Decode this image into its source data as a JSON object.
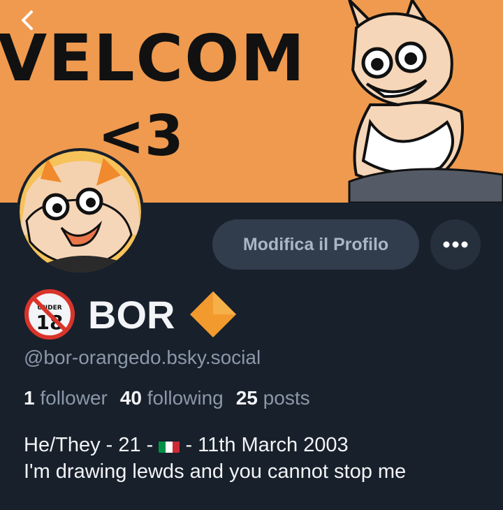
{
  "banner": {
    "text_line1": "VELCOM",
    "text_line2": "<3",
    "background_color": "#ef9a4f"
  },
  "nav": {
    "back_icon": "chevron-left-icon"
  },
  "profile": {
    "display_name": "BOR",
    "name_prefix_icon": "under-18-icon",
    "name_suffix_icon": "orange-diamond-icon",
    "handle": "@bor-orangedo.bsky.social"
  },
  "actions": {
    "edit_label": "Modifica il Profilo",
    "more_icon": "more-dots-icon"
  },
  "stats": {
    "followers_count": "1",
    "followers_label": "follower",
    "following_count": "40",
    "following_label": "following",
    "posts_count": "25",
    "posts_label": "posts"
  },
  "bio": {
    "line1_before_flag": "He/They - 21 - ",
    "flag_icon": "italy-flag-icon",
    "line1_after_flag": " - 11th March 2003",
    "line2": "I'm drawing lewds and you cannot stop me"
  },
  "colors": {
    "background": "#18202b",
    "accent_orange": "#ef9a4f",
    "muted_text": "#8b98a9",
    "button_bg": "#313d4c"
  }
}
